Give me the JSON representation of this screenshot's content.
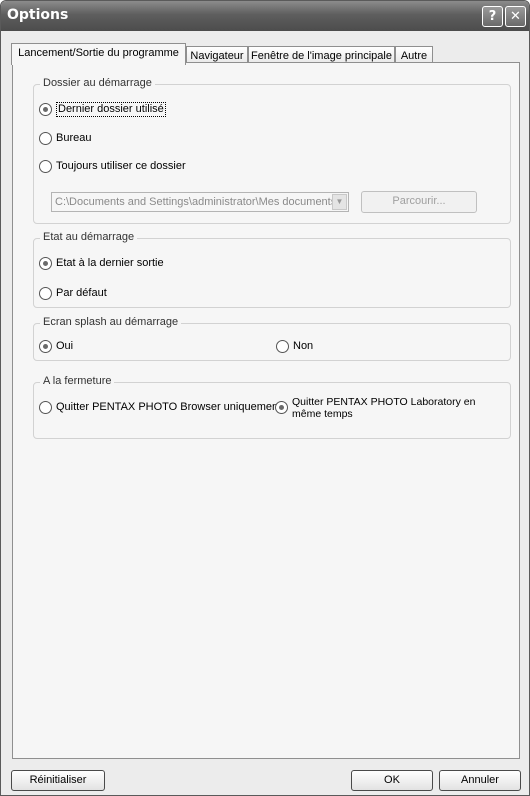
{
  "window": {
    "title": "Options",
    "help_glyph": "?",
    "close_glyph": "✕"
  },
  "tabs": [
    {
      "label": "Lancement/Sortie du programme",
      "active": true
    },
    {
      "label": "Navigateur",
      "active": false
    },
    {
      "label": "Fenêtre de l'image principale",
      "active": false
    },
    {
      "label": "Autre",
      "active": false
    }
  ],
  "startup_folder": {
    "title": "Dossier au démarrage",
    "options": [
      {
        "label": "Dernier dossier utilisé",
        "selected": true
      },
      {
        "label": "Bureau",
        "selected": false
      },
      {
        "label": "Toujours utiliser ce dossier",
        "selected": false
      }
    ],
    "path_value": "C:\\Documents and Settings\\administrator\\Mes documents",
    "browse_label": "Parcourir..."
  },
  "startup_state": {
    "title": "Etat au démarrage",
    "options": [
      {
        "label": "Etat à la dernier sortie",
        "selected": true
      },
      {
        "label": "Par défaut",
        "selected": false
      }
    ]
  },
  "splash": {
    "title": "Ecran splash au démarrage",
    "options": [
      {
        "label": "Oui",
        "selected": true
      },
      {
        "label": "Non",
        "selected": false
      }
    ]
  },
  "on_close": {
    "title": "A la fermeture",
    "options": [
      {
        "label": "Quitter PENTAX PHOTO Browser uniquement",
        "selected": false
      },
      {
        "label": "Quitter PENTAX PHOTO Laboratory en",
        "label_line2": "même temps",
        "selected": true
      }
    ]
  },
  "footer": {
    "reset_label": "Réinitialiser",
    "ok_label": "OK",
    "cancel_label": "Annuler"
  }
}
